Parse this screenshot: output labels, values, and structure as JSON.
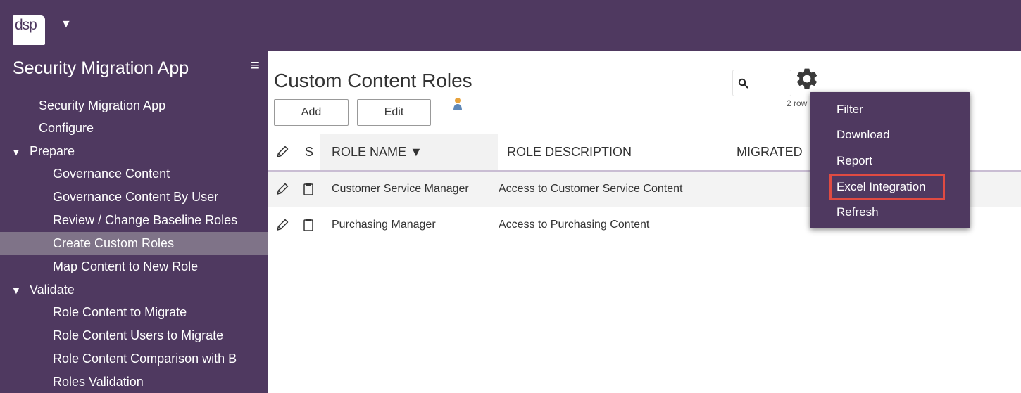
{
  "header": {
    "logo_text": "dsp",
    "logo_caret": "▼"
  },
  "sidebar": {
    "title": "Security Migration App",
    "menu_icon": "≡",
    "items": [
      {
        "label": "Security Migration App",
        "level": 1
      },
      {
        "label": "Configure",
        "level": 1
      },
      {
        "label": "Prepare",
        "level": 0,
        "expanded": true
      },
      {
        "label": "Governance Content",
        "level": 2
      },
      {
        "label": "Governance Content By User",
        "level": 2
      },
      {
        "label": "Review / Change Baseline Roles",
        "level": 2
      },
      {
        "label": "Create Custom Roles",
        "level": 2,
        "active": true
      },
      {
        "label": "Map Content to New Role",
        "level": 2
      },
      {
        "label": "Validate",
        "level": 0,
        "expanded": true
      },
      {
        "label": "Role Content to Migrate",
        "level": 2
      },
      {
        "label": "Role Content Users to Migrate",
        "level": 2
      },
      {
        "label": "Role Content Comparison with B",
        "level": 2
      },
      {
        "label": "Roles Validation",
        "level": 2
      }
    ]
  },
  "main": {
    "title": "Custom Content Roles",
    "add_label": "Add",
    "edit_label": "Edit",
    "search_placeholder": "",
    "rows_label": "2 row",
    "columns": {
      "s": "S",
      "role_name": "ROLE NAME ▼",
      "role_description": "ROLE DESCRIPTION",
      "migrated": "MIGRATED"
    },
    "rows": [
      {
        "role_name": "Customer Service Manager",
        "role_description": "Access to Customer Service Content"
      },
      {
        "role_name": "Purchasing Manager",
        "role_description": "Access to Purchasing Content"
      }
    ]
  },
  "gear_menu": {
    "items": [
      {
        "label": "Filter"
      },
      {
        "label": "Download"
      },
      {
        "label": "Report"
      },
      {
        "label": "Excel Integration",
        "highlighted": true
      },
      {
        "label": "Refresh"
      }
    ]
  },
  "colors": {
    "brand_purple": "#4f3960",
    "active_nav": "#7f7388",
    "highlight_border": "#e04b42"
  }
}
